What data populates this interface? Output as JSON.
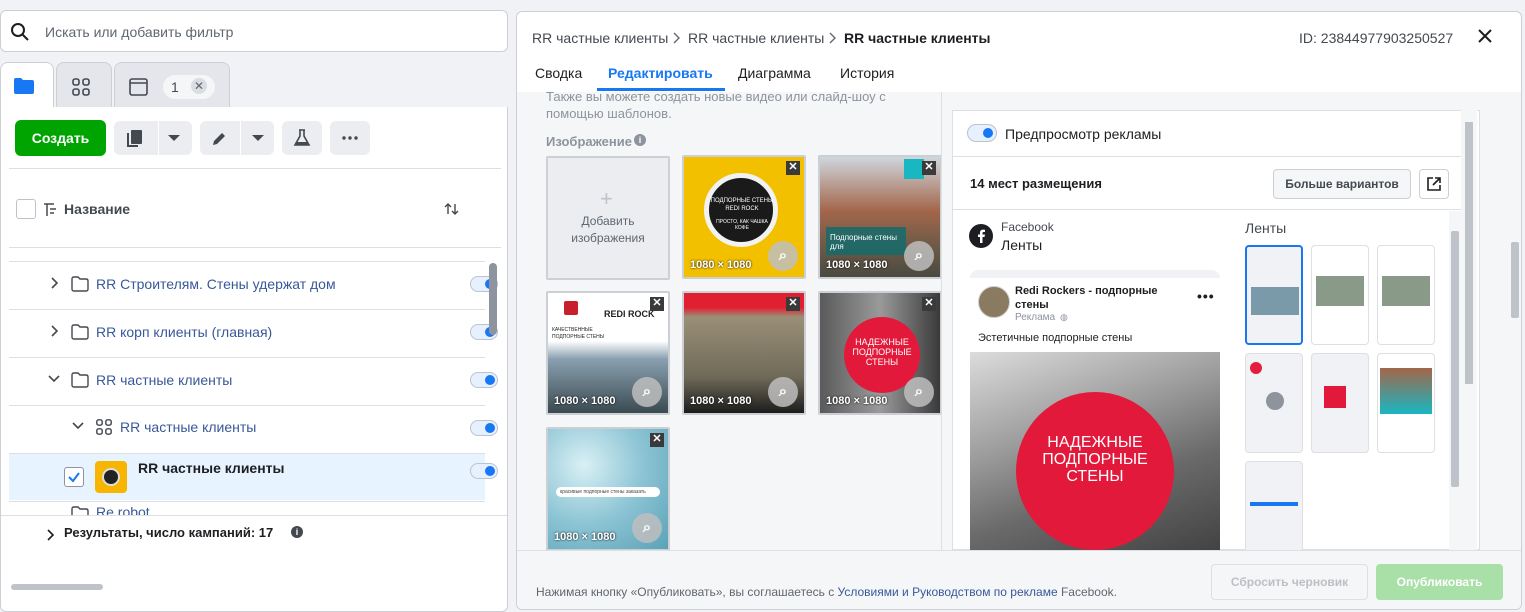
{
  "search": {
    "placeholder": "Искать или добавить фильтр"
  },
  "left_tabs": {
    "selected_count": "1"
  },
  "toolbar": {
    "create_label": "Создать"
  },
  "table": {
    "header_label": "Название",
    "rows": [
      {
        "label": "RR Строителям. Стены удержат дом"
      },
      {
        "label": "RR корп клиенты (главная)"
      },
      {
        "label": "RR частные клиенты"
      },
      {
        "label": "RR частные клиенты"
      },
      {
        "label": "RR частные клиенты"
      },
      {
        "label": "Re robot"
      }
    ],
    "results_label": "Результаты, число кампаний: 17"
  },
  "breadcrumb": {
    "items": [
      "RR частные клиенты",
      "RR частные клиенты",
      "RR частные клиенты"
    ],
    "id_label": "ID: 23844977903250527"
  },
  "tabs": [
    "Сводка",
    "Редактировать",
    "Диаграмма",
    "История"
  ],
  "editor": {
    "intro_text_1": "Также вы можете создать новые видео или слайд-шоу с",
    "intro_text_2": "помощью шаблонов.",
    "image_section_label": "Изображение",
    "add_images_line1": "Добавить",
    "add_images_line2": "изображения",
    "image_size": "1080 × 1080",
    "img1_text": "ПОДПОРНЫЕ СТЕНЫ REDI ROCK",
    "img1_text2": "ПРОСТО, КАК ЧАШКА КОФЕ",
    "img2_text": "Подпорные стены для",
    "img3_brand": "REDI ROCK",
    "img3_sub": "КАЧЕСТВЕННЫЕ ПОДПОРНЫЕ СТЕНЫ",
    "img5_text": "НАДЕЖНЫЕ ПОДПОРНЫЕ СТЕНЫ",
    "img7_text": "красивые подпорные стены заказать"
  },
  "preview": {
    "toggle_label": "Предпросмотр рекламы",
    "placements_label": "14 мест размещения",
    "more_button": "Больше вариантов",
    "platform": "Facebook",
    "placement": "Ленты",
    "feeds_label": "Ленты",
    "page_name": "Redi Rockers - подпорные стены",
    "sponsored": "Реклама",
    "ad_text": "Эстетичные подпорные стены",
    "ad_image_text": "НАДЕЖНЫЕ ПОДПОРНЫЕ СТЕНЫ"
  },
  "footer": {
    "text_prefix": "Нажимая кнопку «Опубликовать», вы соглашаетесь с ",
    "link_text": "Условиями и Руководством по рекламе",
    "text_suffix": " Facebook.",
    "reset_label": "Сбросить черновик",
    "publish_label": "Опубликовать"
  },
  "colors": {
    "accent": "#1877f2",
    "create_green": "#00a400",
    "publish_green": "#a9e0a8",
    "link": "#385898"
  }
}
